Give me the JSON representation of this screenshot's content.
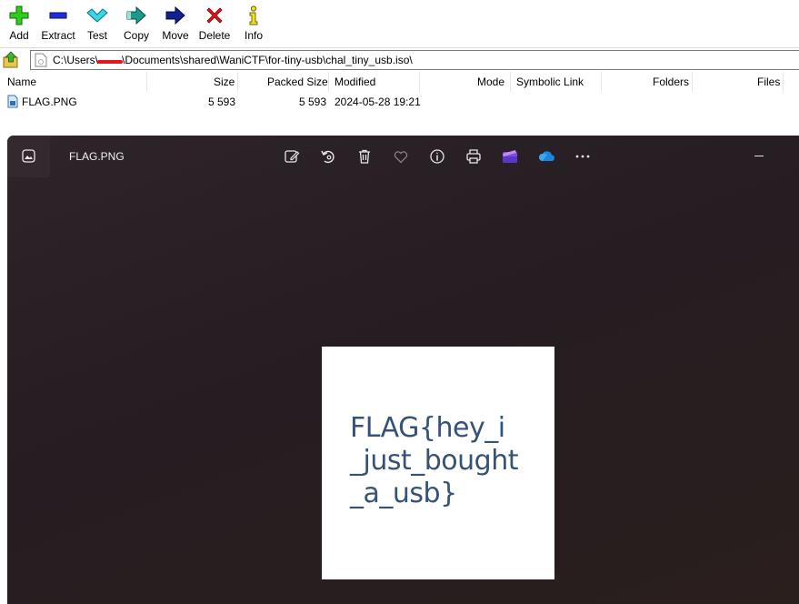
{
  "toolbar": {
    "buttons": [
      {
        "label": "Add",
        "icon": "plus-icon"
      },
      {
        "label": "Extract",
        "icon": "minus-icon"
      },
      {
        "label": "Test",
        "icon": "check-icon"
      },
      {
        "label": "Copy",
        "icon": "copy-arrow-icon"
      },
      {
        "label": "Move",
        "icon": "move-arrow-icon"
      },
      {
        "label": "Delete",
        "icon": "x-icon"
      },
      {
        "label": "Info",
        "icon": "info-icon"
      }
    ]
  },
  "address": {
    "path_prefix": "C:\\Users\\",
    "path_suffix": "\\Documents\\shared\\WaniCTF\\for-tiny-usb\\chal_tiny_usb.iso\\"
  },
  "columns": {
    "name": "Name",
    "size": "Size",
    "packed_size": "Packed Size",
    "modified": "Modified",
    "mode": "Mode",
    "symbolic_link": "Symbolic Link",
    "folders": "Folders",
    "files": "Files"
  },
  "files": [
    {
      "name": "FLAG.PNG",
      "size": "5 593",
      "packed_size": "5 593",
      "modified": "2024-05-28 19:21"
    }
  ],
  "viewer": {
    "title": "FLAG.PNG",
    "image_text": "FLAG{hey_i\n_just_bought\n_a_usb}",
    "colors": {
      "text": "#355279",
      "background": "#251d22"
    }
  }
}
